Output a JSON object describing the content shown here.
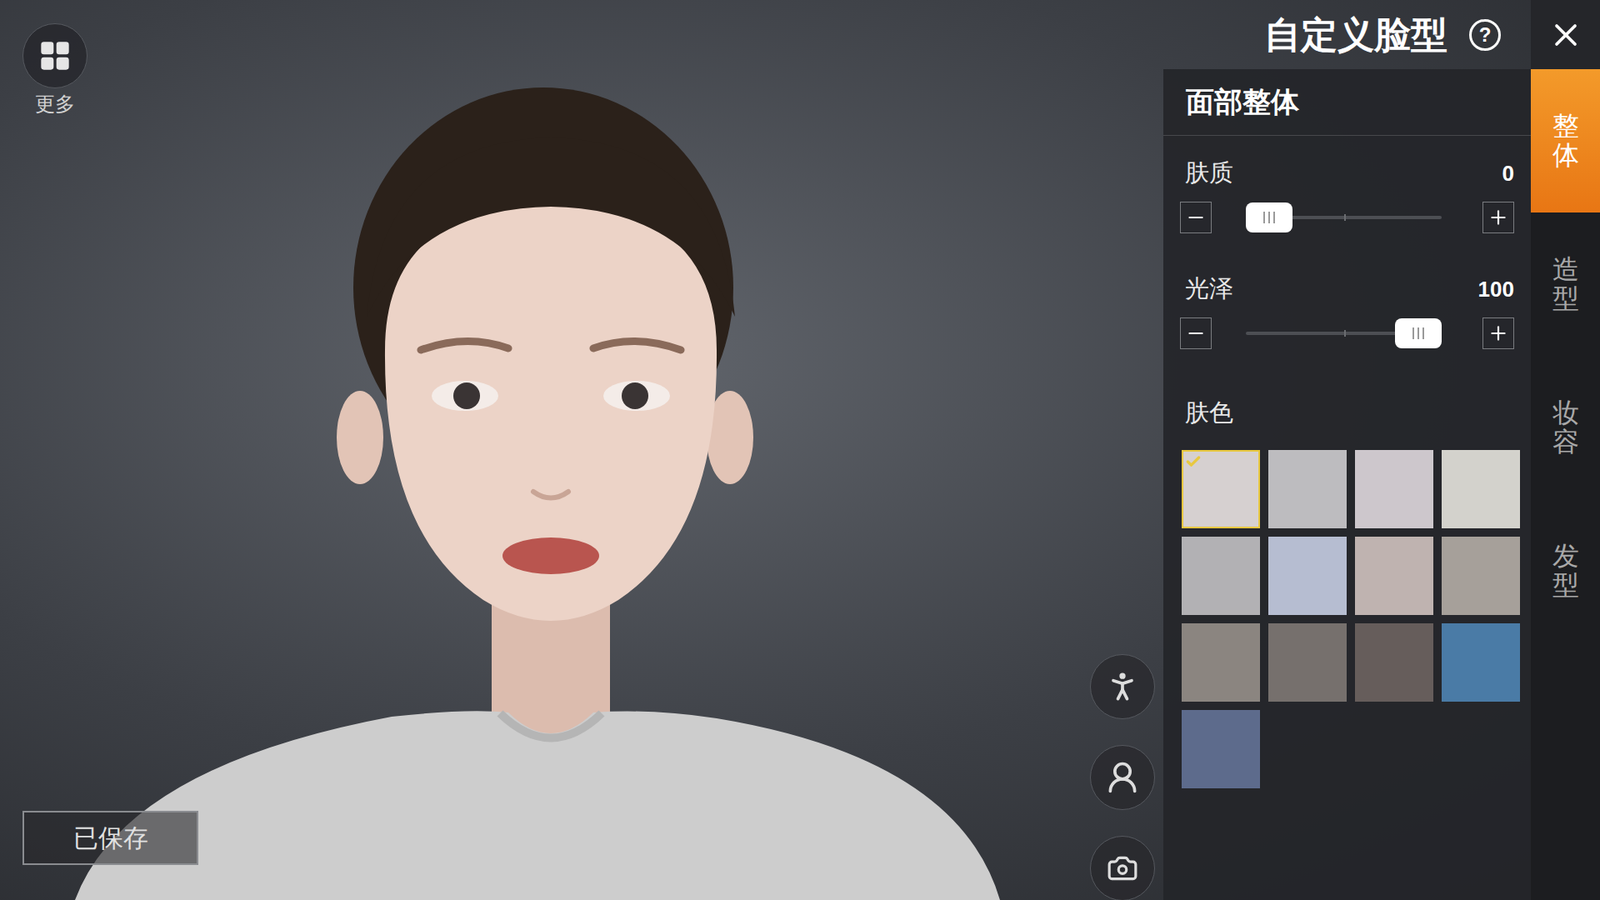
{
  "more": {
    "label": "更多"
  },
  "title": "自定义脸型",
  "help": "?",
  "tabs": [
    {
      "label": "整体",
      "selected": true
    },
    {
      "label": "造型",
      "selected": false
    },
    {
      "label": "妆容",
      "selected": false
    },
    {
      "label": "发型",
      "selected": false
    }
  ],
  "panel": {
    "title": "面部整体"
  },
  "sliders": [
    {
      "label": "肤质",
      "value": "0",
      "level": 0
    },
    {
      "label": "光泽",
      "value": "100",
      "level": 1
    }
  ],
  "skin_color": {
    "label": "肤色",
    "swatches": [
      {
        "color": "#d6d0d0",
        "selected": true
      },
      {
        "color": "#bdbcbf",
        "selected": false
      },
      {
        "color": "#cdc7cc",
        "selected": false
      },
      {
        "color": "#d3d2cc",
        "selected": false
      },
      {
        "color": "#b2b1b4",
        "selected": false
      },
      {
        "color": "#b6bdd1",
        "selected": false
      },
      {
        "color": "#bfb3b0",
        "selected": false
      },
      {
        "color": "#a6a09a",
        "selected": false
      },
      {
        "color": "#8b8580",
        "selected": false
      },
      {
        "color": "#76706d",
        "selected": false
      },
      {
        "color": "#665d5b",
        "selected": false
      },
      {
        "color": "#4a7ba6",
        "selected": false
      },
      {
        "color": "#5d6b8c",
        "selected": false
      }
    ]
  },
  "save_button": {
    "label": "已保存"
  }
}
